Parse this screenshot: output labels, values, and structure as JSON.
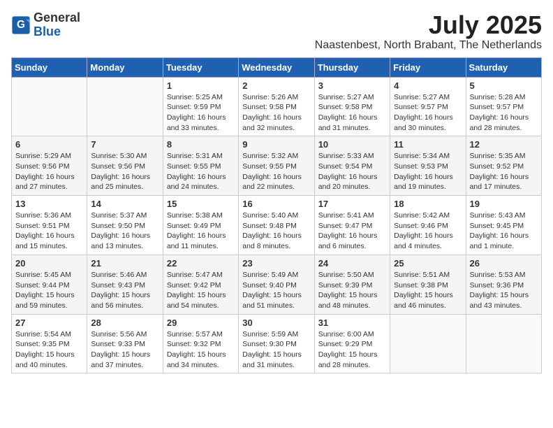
{
  "header": {
    "logo_general": "General",
    "logo_blue": "Blue",
    "month_year": "July 2025",
    "location": "Naastenbest, North Brabant, The Netherlands"
  },
  "days_of_week": [
    "Sunday",
    "Monday",
    "Tuesday",
    "Wednesday",
    "Thursday",
    "Friday",
    "Saturday"
  ],
  "weeks": [
    [
      {
        "day": "",
        "info": ""
      },
      {
        "day": "",
        "info": ""
      },
      {
        "day": "1",
        "info": "Sunrise: 5:25 AM\nSunset: 9:59 PM\nDaylight: 16 hours\nand 33 minutes."
      },
      {
        "day": "2",
        "info": "Sunrise: 5:26 AM\nSunset: 9:58 PM\nDaylight: 16 hours\nand 32 minutes."
      },
      {
        "day": "3",
        "info": "Sunrise: 5:27 AM\nSunset: 9:58 PM\nDaylight: 16 hours\nand 31 minutes."
      },
      {
        "day": "4",
        "info": "Sunrise: 5:27 AM\nSunset: 9:57 PM\nDaylight: 16 hours\nand 30 minutes."
      },
      {
        "day": "5",
        "info": "Sunrise: 5:28 AM\nSunset: 9:57 PM\nDaylight: 16 hours\nand 28 minutes."
      }
    ],
    [
      {
        "day": "6",
        "info": "Sunrise: 5:29 AM\nSunset: 9:56 PM\nDaylight: 16 hours\nand 27 minutes."
      },
      {
        "day": "7",
        "info": "Sunrise: 5:30 AM\nSunset: 9:56 PM\nDaylight: 16 hours\nand 25 minutes."
      },
      {
        "day": "8",
        "info": "Sunrise: 5:31 AM\nSunset: 9:55 PM\nDaylight: 16 hours\nand 24 minutes."
      },
      {
        "day": "9",
        "info": "Sunrise: 5:32 AM\nSunset: 9:55 PM\nDaylight: 16 hours\nand 22 minutes."
      },
      {
        "day": "10",
        "info": "Sunrise: 5:33 AM\nSunset: 9:54 PM\nDaylight: 16 hours\nand 20 minutes."
      },
      {
        "day": "11",
        "info": "Sunrise: 5:34 AM\nSunset: 9:53 PM\nDaylight: 16 hours\nand 19 minutes."
      },
      {
        "day": "12",
        "info": "Sunrise: 5:35 AM\nSunset: 9:52 PM\nDaylight: 16 hours\nand 17 minutes."
      }
    ],
    [
      {
        "day": "13",
        "info": "Sunrise: 5:36 AM\nSunset: 9:51 PM\nDaylight: 16 hours\nand 15 minutes."
      },
      {
        "day": "14",
        "info": "Sunrise: 5:37 AM\nSunset: 9:50 PM\nDaylight: 16 hours\nand 13 minutes."
      },
      {
        "day": "15",
        "info": "Sunrise: 5:38 AM\nSunset: 9:49 PM\nDaylight: 16 hours\nand 11 minutes."
      },
      {
        "day": "16",
        "info": "Sunrise: 5:40 AM\nSunset: 9:48 PM\nDaylight: 16 hours\nand 8 minutes."
      },
      {
        "day": "17",
        "info": "Sunrise: 5:41 AM\nSunset: 9:47 PM\nDaylight: 16 hours\nand 6 minutes."
      },
      {
        "day": "18",
        "info": "Sunrise: 5:42 AM\nSunset: 9:46 PM\nDaylight: 16 hours\nand 4 minutes."
      },
      {
        "day": "19",
        "info": "Sunrise: 5:43 AM\nSunset: 9:45 PM\nDaylight: 16 hours\nand 1 minute."
      }
    ],
    [
      {
        "day": "20",
        "info": "Sunrise: 5:45 AM\nSunset: 9:44 PM\nDaylight: 15 hours\nand 59 minutes."
      },
      {
        "day": "21",
        "info": "Sunrise: 5:46 AM\nSunset: 9:43 PM\nDaylight: 15 hours\nand 56 minutes."
      },
      {
        "day": "22",
        "info": "Sunrise: 5:47 AM\nSunset: 9:42 PM\nDaylight: 15 hours\nand 54 minutes."
      },
      {
        "day": "23",
        "info": "Sunrise: 5:49 AM\nSunset: 9:40 PM\nDaylight: 15 hours\nand 51 minutes."
      },
      {
        "day": "24",
        "info": "Sunrise: 5:50 AM\nSunset: 9:39 PM\nDaylight: 15 hours\nand 48 minutes."
      },
      {
        "day": "25",
        "info": "Sunrise: 5:51 AM\nSunset: 9:38 PM\nDaylight: 15 hours\nand 46 minutes."
      },
      {
        "day": "26",
        "info": "Sunrise: 5:53 AM\nSunset: 9:36 PM\nDaylight: 15 hours\nand 43 minutes."
      }
    ],
    [
      {
        "day": "27",
        "info": "Sunrise: 5:54 AM\nSunset: 9:35 PM\nDaylight: 15 hours\nand 40 minutes."
      },
      {
        "day": "28",
        "info": "Sunrise: 5:56 AM\nSunset: 9:33 PM\nDaylight: 15 hours\nand 37 minutes."
      },
      {
        "day": "29",
        "info": "Sunrise: 5:57 AM\nSunset: 9:32 PM\nDaylight: 15 hours\nand 34 minutes."
      },
      {
        "day": "30",
        "info": "Sunrise: 5:59 AM\nSunset: 9:30 PM\nDaylight: 15 hours\nand 31 minutes."
      },
      {
        "day": "31",
        "info": "Sunrise: 6:00 AM\nSunset: 9:29 PM\nDaylight: 15 hours\nand 28 minutes."
      },
      {
        "day": "",
        "info": ""
      },
      {
        "day": "",
        "info": ""
      }
    ]
  ]
}
